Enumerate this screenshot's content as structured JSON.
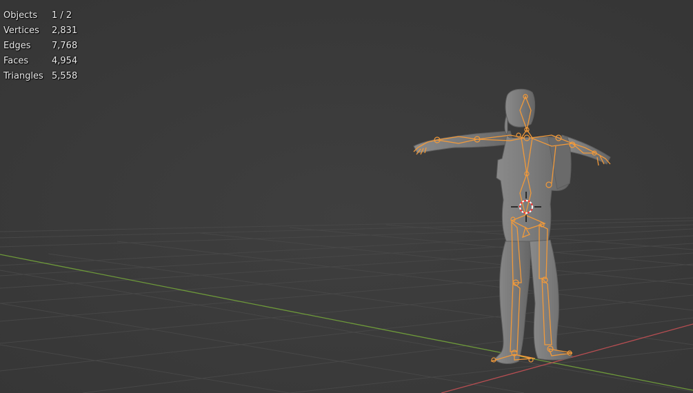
{
  "viewport": {
    "stats": [
      {
        "label": "Objects",
        "value": "1 / 2"
      },
      {
        "label": "Vertices",
        "value": "2,831"
      },
      {
        "label": "Edges",
        "value": "7,768"
      },
      {
        "label": "Faces",
        "value": "4,954"
      },
      {
        "label": "Triangles",
        "value": "5,558"
      }
    ]
  },
  "colors": {
    "background": "#3a3a3a",
    "grid": "#474747",
    "x_axis": "#b84e52",
    "y_axis": "#6e9a3a",
    "mesh": "#7f7f7f",
    "armature_selected": "#f29a3a",
    "cursor": "#ff3333"
  },
  "icons": [
    "3d-cursor-icon"
  ]
}
